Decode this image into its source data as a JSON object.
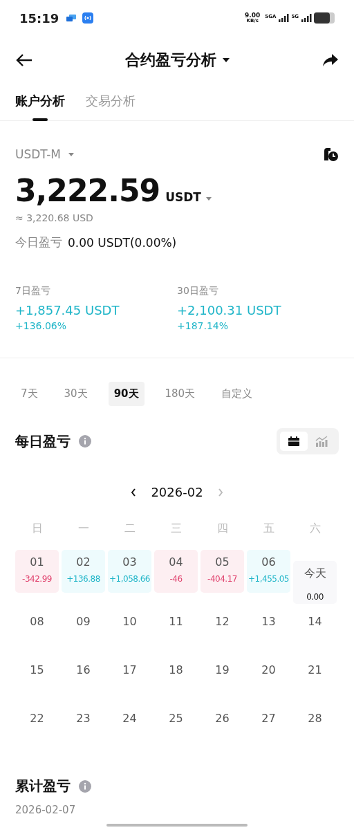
{
  "status_bar": {
    "time": "15:19",
    "speed": "9.00",
    "speed_unit": "KB/s",
    "sim1": "5GA",
    "sim2": "5G"
  },
  "header": {
    "title": "合约盈亏分析"
  },
  "tabs": [
    {
      "label": "账户分析",
      "selected": true
    },
    {
      "label": "交易分析",
      "selected": false
    }
  ],
  "account": {
    "type": "USDT-M",
    "balance": "3,222.59",
    "unit": "USDT",
    "approx": "≈ 3,220.68 USD",
    "today_label": "今日盈亏",
    "today_value": "0.00 USDT(0.00%)"
  },
  "stats": [
    {
      "label": "7日盈亏",
      "value": "+1,857.45 USDT",
      "percent": "+136.06%"
    },
    {
      "label": "30日盈亏",
      "value": "+2,100.31 USDT",
      "percent": "+187.14%"
    }
  ],
  "periods": [
    {
      "label": "7天",
      "selected": false
    },
    {
      "label": "30天",
      "selected": false
    },
    {
      "label": "90天",
      "selected": true
    },
    {
      "label": "180天",
      "selected": false
    },
    {
      "label": "自定义",
      "selected": false
    }
  ],
  "daily": {
    "title": "每日盈亏",
    "views": [
      {
        "kind": "calendar",
        "selected": true
      },
      {
        "kind": "chart",
        "selected": false
      }
    ],
    "month": "2026-02",
    "weekdays": [
      "日",
      "一",
      "二",
      "三",
      "四",
      "五",
      "六"
    ],
    "days": [
      {
        "label": "01",
        "value": "-342.99",
        "kind": "loss"
      },
      {
        "label": "02",
        "value": "+136.88",
        "kind": "gain"
      },
      {
        "label": "03",
        "value": "+1,058.66",
        "kind": "gain"
      },
      {
        "label": "04",
        "value": "-46",
        "kind": "loss"
      },
      {
        "label": "05",
        "value": "-404.17",
        "kind": "loss"
      },
      {
        "label": "06",
        "value": "+1,455.05",
        "kind": "gain"
      },
      {
        "label": "今天",
        "value": "0.00",
        "kind": "today"
      },
      {
        "label": "08",
        "kind": "plain"
      },
      {
        "label": "09",
        "kind": "plain"
      },
      {
        "label": "10",
        "kind": "plain"
      },
      {
        "label": "11",
        "kind": "plain"
      },
      {
        "label": "12",
        "kind": "plain"
      },
      {
        "label": "13",
        "kind": "plain"
      },
      {
        "label": "14",
        "kind": "plain"
      },
      {
        "label": "15",
        "kind": "plain"
      },
      {
        "label": "16",
        "kind": "plain"
      },
      {
        "label": "17",
        "kind": "plain"
      },
      {
        "label": "18",
        "kind": "plain"
      },
      {
        "label": "19",
        "kind": "plain"
      },
      {
        "label": "20",
        "kind": "plain"
      },
      {
        "label": "21",
        "kind": "plain"
      },
      {
        "label": "22",
        "kind": "plain"
      },
      {
        "label": "23",
        "kind": "plain"
      },
      {
        "label": "24",
        "kind": "plain"
      },
      {
        "label": "25",
        "kind": "plain"
      },
      {
        "label": "26",
        "kind": "plain"
      },
      {
        "label": "27",
        "kind": "plain"
      },
      {
        "label": "28",
        "kind": "plain"
      }
    ]
  },
  "cumulative": {
    "title": "累计盈亏",
    "date": "2026-02-07"
  }
}
